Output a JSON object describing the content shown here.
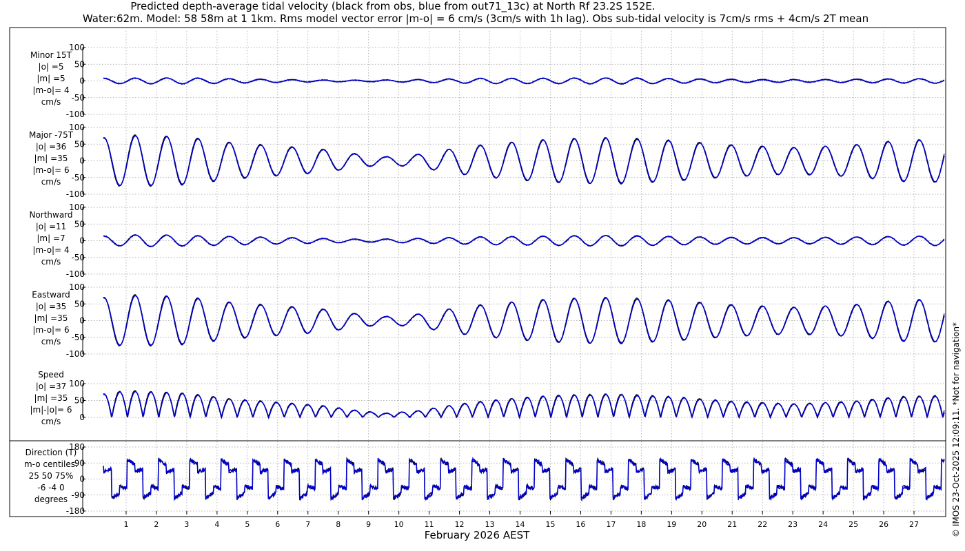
{
  "title": {
    "line1": "Predicted depth-average tidal velocity (black from obs, blue from out71_13c) at North Rf 23.2S 152E.",
    "line2": "Water:62m. Model: 58 58m at 1 1km. Rms model vector error |m-o| = 6 cm/s (3cm/s with 1h lag). Obs sub-tidal velocity is 7cm/s rms + 4cm/s 2T mean"
  },
  "watermark": "© IMOS 23-Oct-2025 12:09:11. *Not for navigation*",
  "colors": {
    "obs": "#000000",
    "model": "#0000cc",
    "grid": "#9a9a9a"
  },
  "chart_data": {
    "type": "line",
    "xlabel": "February 2026 AEST",
    "x_ticks": [
      "1",
      "2",
      "3",
      "4",
      "5",
      "6",
      "7",
      "8",
      "9",
      "10",
      "11",
      "12",
      "13",
      "14",
      "15",
      "16",
      "17",
      "18",
      "19",
      "20",
      "21",
      "22",
      "23",
      "24",
      "25",
      "26",
      "27"
    ],
    "xlim": [
      0.25,
      28.0
    ],
    "grid": true,
    "series_names": [
      "obs",
      "out71_13c"
    ],
    "panels": [
      {
        "id": "minor",
        "label_lines": [
          "Minor 15T",
          "|o| =5",
          "|m| =5",
          "|m-o|= 4",
          "cm/s"
        ],
        "ylim": [
          -100,
          100
        ],
        "yticks": [
          "100",
          "50",
          "0",
          "-50",
          "-100"
        ],
        "ytick_values": [
          100,
          50,
          0,
          -50,
          -100
        ],
        "envelope": [
          {
            "x": 0.25,
            "amp": 8
          },
          {
            "x": 3.0,
            "amp": 9
          },
          {
            "x": 5.0,
            "amp": 6
          },
          {
            "x": 7.0,
            "amp": 3
          },
          {
            "x": 9.0,
            "amp": 2
          },
          {
            "x": 11.0,
            "amp": 5
          },
          {
            "x": 13.0,
            "amp": 8
          },
          {
            "x": 15.0,
            "amp": 8
          },
          {
            "x": 17.5,
            "amp": 9
          },
          {
            "x": 20.0,
            "amp": 6
          },
          {
            "x": 22.0,
            "amp": 4
          },
          {
            "x": 24.0,
            "amp": 4
          },
          {
            "x": 26.0,
            "amp": 6
          },
          {
            "x": 28.0,
            "amp": 7
          }
        ]
      },
      {
        "id": "major",
        "label_lines": [
          "Major -75T",
          "|o| =36",
          "|m| =35",
          "|m-o|= 6",
          "cm/s"
        ],
        "ylim": [
          -100,
          100
        ],
        "yticks": [
          "100",
          "50",
          "0",
          "-50",
          "-100"
        ],
        "ytick_values": [
          100,
          50,
          0,
          -50,
          -100
        ],
        "envelope": [
          {
            "x": 0.25,
            "amp": 70
          },
          {
            "x": 1.0,
            "amp": 78
          },
          {
            "x": 3.0,
            "amp": 72
          },
          {
            "x": 4.5,
            "amp": 55
          },
          {
            "x": 6.0,
            "amp": 45
          },
          {
            "x": 7.5,
            "amp": 35
          },
          {
            "x": 8.5,
            "amp": 22
          },
          {
            "x": 9.5,
            "amp": 12
          },
          {
            "x": 10.5,
            "amp": 18
          },
          {
            "x": 12.0,
            "amp": 40
          },
          {
            "x": 13.5,
            "amp": 55
          },
          {
            "x": 15.0,
            "amp": 65
          },
          {
            "x": 17.0,
            "amp": 70
          },
          {
            "x": 19.0,
            "amp": 62
          },
          {
            "x": 21.0,
            "amp": 48
          },
          {
            "x": 23.0,
            "amp": 40
          },
          {
            "x": 25.0,
            "amp": 48
          },
          {
            "x": 26.5,
            "amp": 62
          },
          {
            "x": 28.0,
            "amp": 65
          }
        ]
      },
      {
        "id": "northward",
        "label_lines": [
          "Northward",
          "|o| =11",
          "|m| =7",
          "|m-o|= 4",
          "cm/s"
        ],
        "ylim": [
          -100,
          100
        ],
        "yticks": [
          "100",
          "50",
          "0",
          "-50",
          "-100"
        ],
        "ytick_values": [
          100,
          50,
          0,
          -50,
          -100
        ],
        "envelope": [
          {
            "x": 0.25,
            "amp": 14
          },
          {
            "x": 1.5,
            "amp": 18
          },
          {
            "x": 3.0,
            "amp": 16
          },
          {
            "x": 5.0,
            "amp": 12
          },
          {
            "x": 7.0,
            "amp": 8
          },
          {
            "x": 9.0,
            "amp": 4
          },
          {
            "x": 11.0,
            "amp": 8
          },
          {
            "x": 13.0,
            "amp": 12
          },
          {
            "x": 15.0,
            "amp": 14
          },
          {
            "x": 17.0,
            "amp": 16
          },
          {
            "x": 19.0,
            "amp": 13
          },
          {
            "x": 21.0,
            "amp": 10
          },
          {
            "x": 23.0,
            "amp": 9
          },
          {
            "x": 25.0,
            "amp": 11
          },
          {
            "x": 28.0,
            "amp": 15
          }
        ]
      },
      {
        "id": "eastward",
        "label_lines": [
          "Eastward",
          "|o| =35",
          "|m| =35",
          "|m-o|= 6",
          "cm/s"
        ],
        "ylim": [
          -100,
          100
        ],
        "yticks": [
          "100",
          "50",
          "0",
          "-50",
          "-100"
        ],
        "ytick_values": [
          100,
          50,
          0,
          -50,
          -100
        ],
        "envelope": [
          {
            "x": 0.25,
            "amp": 70
          },
          {
            "x": 1.0,
            "amp": 78
          },
          {
            "x": 3.0,
            "amp": 72
          },
          {
            "x": 4.5,
            "amp": 55
          },
          {
            "x": 6.0,
            "amp": 45
          },
          {
            "x": 7.5,
            "amp": 35
          },
          {
            "x": 8.5,
            "amp": 22
          },
          {
            "x": 9.5,
            "amp": 12
          },
          {
            "x": 10.5,
            "amp": 18
          },
          {
            "x": 12.0,
            "amp": 40
          },
          {
            "x": 13.5,
            "amp": 55
          },
          {
            "x": 15.0,
            "amp": 65
          },
          {
            "x": 17.0,
            "amp": 70
          },
          {
            "x": 19.0,
            "amp": 62
          },
          {
            "x": 21.0,
            "amp": 48
          },
          {
            "x": 23.0,
            "amp": 40
          },
          {
            "x": 25.0,
            "amp": 48
          },
          {
            "x": 26.5,
            "amp": 62
          },
          {
            "x": 28.0,
            "amp": 65
          }
        ]
      },
      {
        "id": "speed",
        "label_lines": [
          "Speed",
          "|o| =37",
          "|m| =35",
          "|m|-|o|= 6",
          "cm/s"
        ],
        "ylim": [
          0,
          100
        ],
        "yticks": [
          "100",
          "50",
          "0"
        ],
        "ytick_values": [
          100,
          50,
          0
        ],
        "envelope": [
          {
            "x": 0.25,
            "amp": 70
          },
          {
            "x": 1.0,
            "amp": 80
          },
          {
            "x": 3.0,
            "amp": 72
          },
          {
            "x": 4.5,
            "amp": 55
          },
          {
            "x": 6.0,
            "amp": 45
          },
          {
            "x": 7.5,
            "amp": 35
          },
          {
            "x": 8.5,
            "amp": 22
          },
          {
            "x": 9.5,
            "amp": 12
          },
          {
            "x": 10.5,
            "amp": 18
          },
          {
            "x": 12.0,
            "amp": 40
          },
          {
            "x": 13.5,
            "amp": 55
          },
          {
            "x": 15.0,
            "amp": 65
          },
          {
            "x": 17.0,
            "amp": 70
          },
          {
            "x": 19.0,
            "amp": 62
          },
          {
            "x": 21.0,
            "amp": 48
          },
          {
            "x": 23.0,
            "amp": 40
          },
          {
            "x": 25.0,
            "amp": 48
          },
          {
            "x": 26.5,
            "amp": 62
          },
          {
            "x": 28.0,
            "amp": 65
          }
        ]
      },
      {
        "id": "direction",
        "label_lines": [
          "Direction (T)",
          "m-o centiles:",
          "25  50  75%",
          "-6 -4  0",
          "degrees"
        ],
        "ylim": [
          -180,
          180
        ],
        "yticks": [
          "180",
          "90",
          "0",
          "-90",
          "-180"
        ],
        "ytick_values": [
          180,
          90,
          0,
          -90,
          -180
        ],
        "envelope": []
      }
    ]
  }
}
